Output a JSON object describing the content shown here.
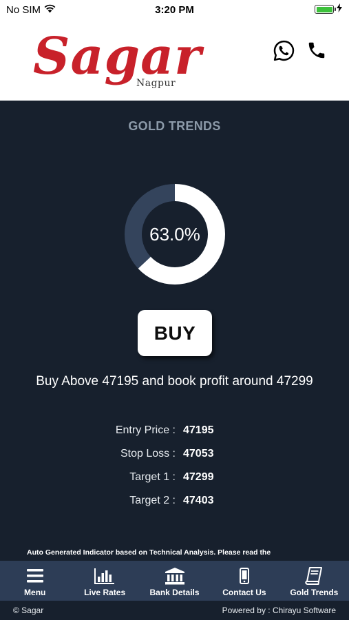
{
  "status_bar": {
    "carrier": "No SIM",
    "time": "3:20 PM"
  },
  "header": {
    "logo_text": "Sagar",
    "logo_subtitle": "Nagpur",
    "brand_color": "#c8212a"
  },
  "main": {
    "title": "GOLD TRENDS",
    "gauge": {
      "value": 0.63,
      "label": "63.0%",
      "fill_color": "#ffffff",
      "track_color": "#34445c"
    },
    "signal_button": "BUY",
    "signal_text": "Buy Above 47195 and book profit around 47299",
    "levels": [
      {
        "label": "Entry Price :",
        "value": "47195"
      },
      {
        "label": "Stop Loss :",
        "value": "47053"
      },
      {
        "label": "Target 1 :",
        "value": "47299"
      },
      {
        "label": "Target 2 :",
        "value": "47403"
      }
    ],
    "disclaimer": "Auto Generated Indicator based on Technical Analysis. Please read the"
  },
  "nav": {
    "items": [
      {
        "label": "Menu",
        "icon": "hamburger-icon"
      },
      {
        "label": "Live Rates",
        "icon": "bar-chart-icon"
      },
      {
        "label": "Bank Details",
        "icon": "bank-icon"
      },
      {
        "label": "Contact Us",
        "icon": "mobile-phone-icon"
      },
      {
        "label": "Gold Trends",
        "icon": "book-icon"
      }
    ]
  },
  "footer": {
    "copyright": "© Sagar",
    "powered_by": "Powered by : Chirayu Software"
  }
}
